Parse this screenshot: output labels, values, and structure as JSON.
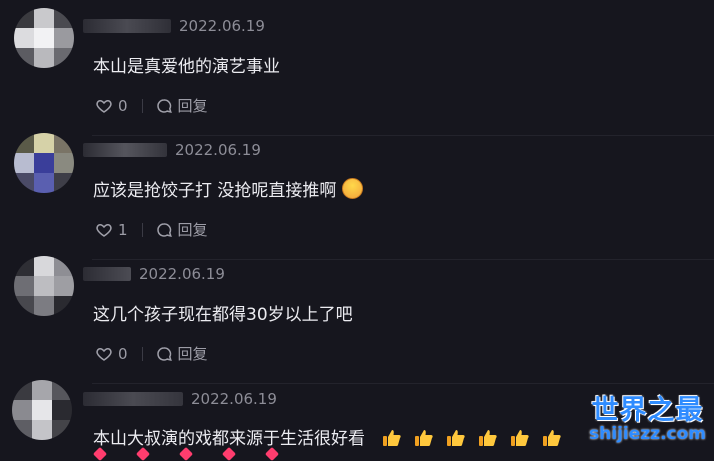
{
  "reply_label": "回复",
  "comments": [
    {
      "date": "2022.06.19",
      "text": "本山是真爱他的演艺事业",
      "likes": "0",
      "emoji": ""
    },
    {
      "date": "2022.06.19",
      "text": "应该是抢饺子打 没抢呢直接推啊",
      "likes": "1",
      "emoji": "grinning-face-emoji"
    },
    {
      "date": "2022.06.19",
      "text": "这几个孩子现在都得30岁以上了吧",
      "likes": "0",
      "emoji": ""
    },
    {
      "date": "2022.06.19",
      "text": "本山大叔演的戏都来源于生活很好看",
      "likes": "",
      "emoji": "thumbs-up-emoji"
    }
  ],
  "watermark": {
    "line1": "世界之最",
    "line2": "shijiezz.com"
  },
  "colors": {
    "background": "#16161e",
    "date": "#8d8d97",
    "accent": "#2f8cff"
  }
}
